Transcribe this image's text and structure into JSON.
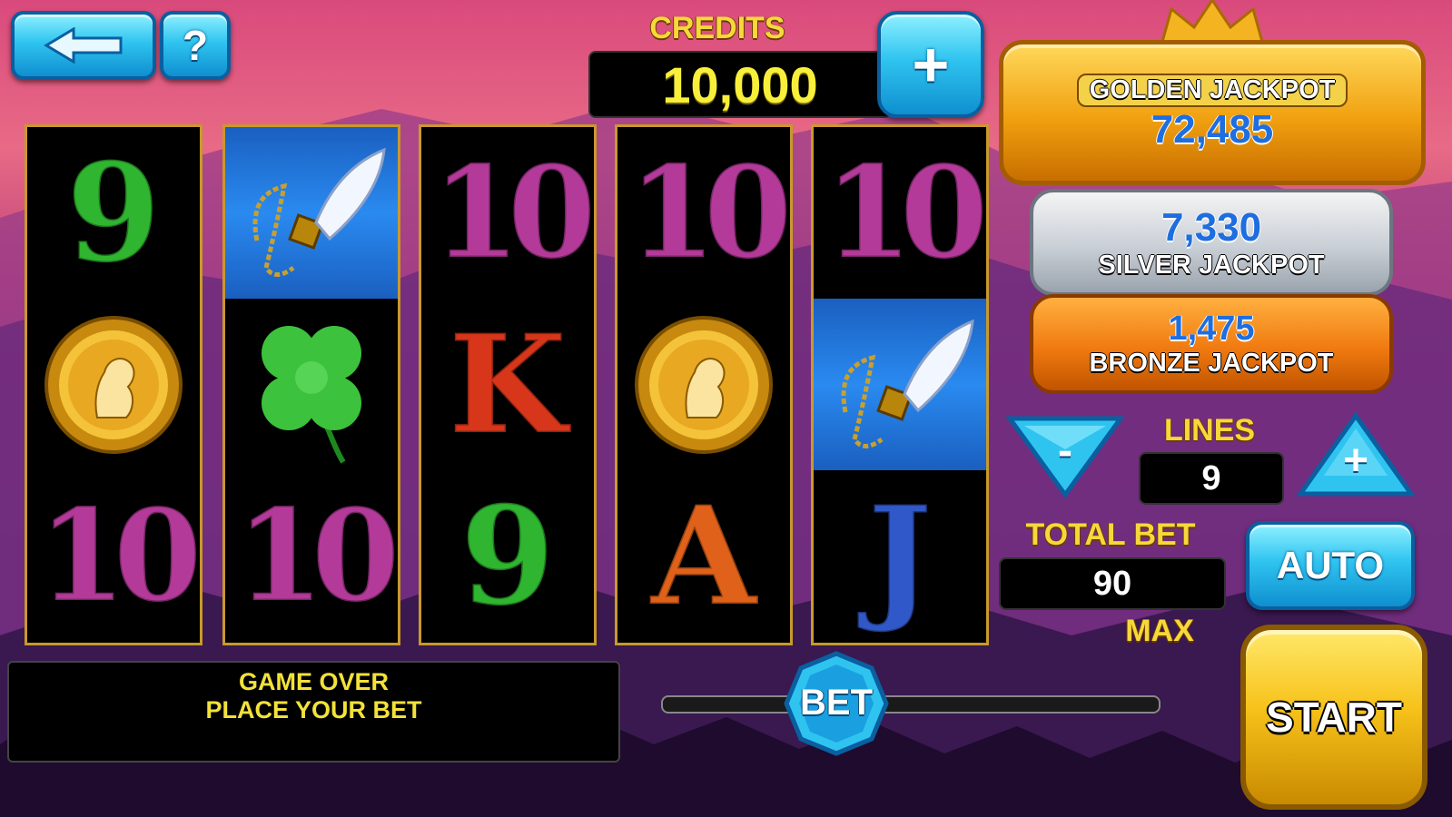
{
  "topbar": {
    "back_icon": "back-arrow-icon",
    "help_label": "?",
    "credits_label": "CREDITS",
    "credits_value": "10,000",
    "add_credits_label": "+"
  },
  "reels": [
    [
      "9",
      "coin",
      "10"
    ],
    [
      "necklace",
      "clover",
      "10"
    ],
    [
      "10",
      "K",
      "9"
    ],
    [
      "10",
      "coin",
      "A"
    ],
    [
      "10",
      "necklace",
      "J"
    ]
  ],
  "jackpots": {
    "golden": {
      "name": "GOLDEN JACKPOT",
      "value": "72,485"
    },
    "silver": {
      "name": "SILVER JACKPOT",
      "value": "7,330"
    },
    "bronze": {
      "name": "BRONZE JACKPOT",
      "value": "1,475"
    }
  },
  "controls": {
    "lines_label": "LINES",
    "lines_value": "9",
    "minus_label": "-",
    "plus_label": "+",
    "total_bet_label": "TOTAL BET",
    "total_bet_value": "90",
    "max_label": "MAX",
    "auto_label": "AUTO",
    "start_label": "START",
    "bet_label": "BET"
  },
  "message": {
    "line1": "GAME OVER",
    "line2": "PLACE YOUR BET"
  },
  "colors": {
    "gold_text": "#f7d83a",
    "jackpot_value": "#1f6ee0",
    "gem_blue": "#2fc4f0"
  }
}
